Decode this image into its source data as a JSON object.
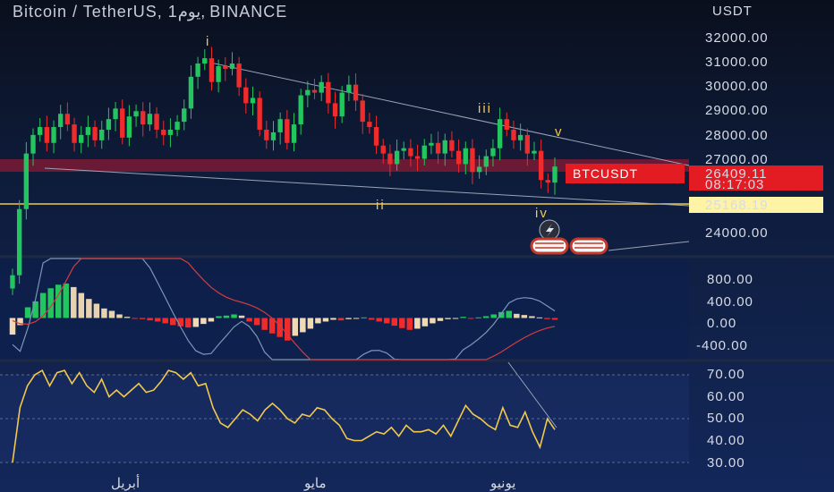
{
  "header": {
    "title": "Bitcoin / TetherUS, 1يوم, BINANCE",
    "currency": "USDT"
  },
  "price_tags": {
    "symbol": "BTCUSDT",
    "last_price": "26409.11",
    "countdown": "08:17:03",
    "level": "25168.19"
  },
  "waves": [
    "i",
    "ii",
    "iii",
    "iv",
    "v"
  ],
  "x_labels": [
    "أبريل",
    "مايو",
    "يونيو"
  ],
  "colors": {
    "up": "#22c55e",
    "down": "#ef2b2b",
    "rsi": "#f2c94c",
    "level_line": "#f2c94c",
    "tag_red": "#e31b23",
    "tag_yellow": "#fff3a6"
  },
  "chart_data": [
    {
      "type": "candlestick",
      "yaxis_ticks": [
        "32000.00",
        "31000.00",
        "30000.00",
        "29000.00",
        "28000.00",
        "27000.00",
        "24000.00"
      ],
      "ylim": [
        23000,
        32700
      ],
      "horizontal_level": 25168.19,
      "support_zone": [
        26200,
        26600
      ],
      "close": [
        22300,
        24800,
        26900,
        27600,
        27900,
        27300,
        27900,
        28400,
        28000,
        27300,
        27600,
        27900,
        27400,
        27800,
        28200,
        28600,
        27500,
        28300,
        28500,
        28000,
        28400,
        27800,
        27600,
        27800,
        28100,
        28600,
        29800,
        30300,
        30500,
        29600,
        30200,
        30100,
        30300,
        29400,
        28800,
        29000,
        27800,
        27400,
        27700,
        28200,
        27300,
        28000,
        29100,
        29300,
        29200,
        29600,
        28800,
        28300,
        29200,
        29500,
        28900,
        28100,
        27900,
        27200,
        26900,
        26500,
        27000,
        27100,
        26800,
        26700,
        27200,
        27300,
        26900,
        27400,
        27000,
        26500,
        27100,
        26200,
        26400,
        26800,
        27100,
        28200,
        27800,
        27400,
        27600,
        26900,
        27000,
        25900,
        25800,
        26409
      ],
      "rsi": {
        "range": [
          30,
          70
        ],
        "yaxis_ticks": [
          "70.00",
          "60.00",
          "50.00",
          "40.00",
          "30.00"
        ],
        "values": [
          30,
          55,
          65,
          70,
          72,
          65,
          71,
          72,
          66,
          71,
          65,
          62,
          68,
          60,
          63,
          60,
          63,
          66,
          62,
          63,
          67,
          72,
          71,
          68,
          71,
          65,
          66,
          55,
          48,
          46,
          50,
          54,
          52,
          49,
          54,
          57,
          54,
          50,
          48,
          52,
          51,
          55,
          54,
          50,
          47,
          41,
          40,
          40,
          42,
          44,
          43,
          46,
          42,
          47,
          44,
          44,
          45,
          43,
          47,
          42,
          49,
          56,
          52,
          50,
          47,
          45,
          55,
          47,
          46,
          53,
          44,
          37,
          50,
          45
        ]
      },
      "macd": {
        "yaxis_ticks": [
          "800.00",
          "400.00",
          "0.00",
          "-400.00"
        ],
        "range": [
          -700,
          1000
        ],
        "histogram": [
          -280,
          -120,
          180,
          280,
          420,
          500,
          560,
          580,
          520,
          420,
          320,
          240,
          160,
          120,
          60,
          20,
          -10,
          -20,
          -40,
          -60,
          -90,
          -120,
          -140,
          -160,
          -150,
          -100,
          -60,
          30,
          40,
          60,
          40,
          -60,
          -120,
          -200,
          -260,
          -320,
          -380,
          -300,
          -240,
          -180,
          -90,
          -60,
          -30,
          -40,
          -20,
          -10,
          10,
          -30,
          -60,
          -90,
          -130,
          -170,
          -200,
          -180,
          -140,
          -90,
          -50,
          -20,
          -10,
          20,
          -10,
          10,
          30,
          60,
          100,
          120,
          70,
          50,
          30,
          10,
          -20,
          -30
        ]
      },
      "annotations": [
        "i",
        "ii",
        "iii",
        "iv",
        "v"
      ]
    }
  ]
}
